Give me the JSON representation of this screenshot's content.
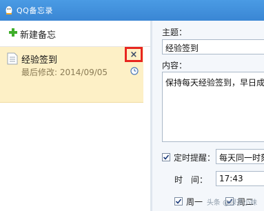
{
  "window": {
    "title": "QQ备忘录"
  },
  "sidebar": {
    "new_memo_label": "新建备忘",
    "memos": [
      {
        "title": "经验签到",
        "date": "最后修改: 2014/09/05"
      }
    ],
    "close_glyph": "×"
  },
  "editor": {
    "subject_label": "主题：",
    "subject_value": "经验签到",
    "content_label": "内容：",
    "content_value": "保持每天经验签到，早日成",
    "reminder_label": "定时提醒：",
    "reminder_checked": true,
    "reminder_value": "每天同一时刻",
    "time_label": "时　间：",
    "time_value": "17:43",
    "weekday1_label": "周一",
    "weekday2_label": "周二"
  },
  "watermark": "头条 @绿茶小妹",
  "colors": {
    "titlebar": "#3a86d4",
    "selected_memo": "#fdf0c6",
    "highlight_box": "#e8261f"
  }
}
